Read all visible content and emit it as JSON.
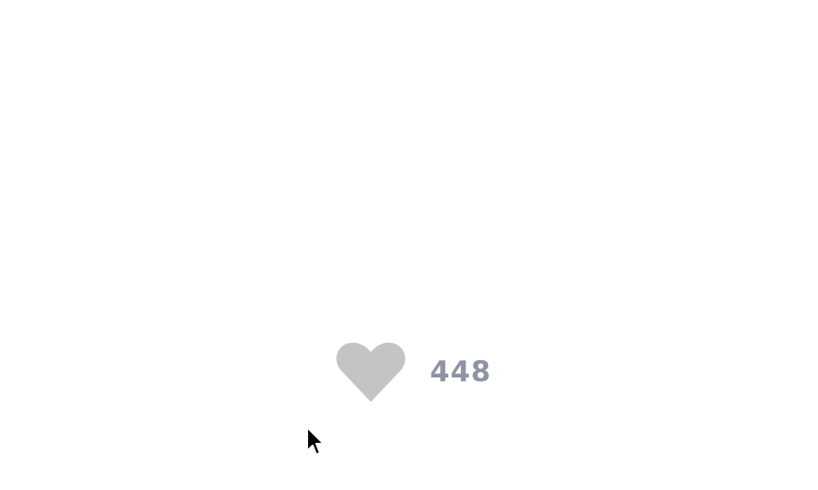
{
  "like": {
    "count": "448",
    "icon": "heart-icon",
    "liked": false,
    "heart_color": "#c4c4c4",
    "count_color": "#8d94a3"
  },
  "cursor": {
    "icon": "mouse-pointer-icon"
  }
}
